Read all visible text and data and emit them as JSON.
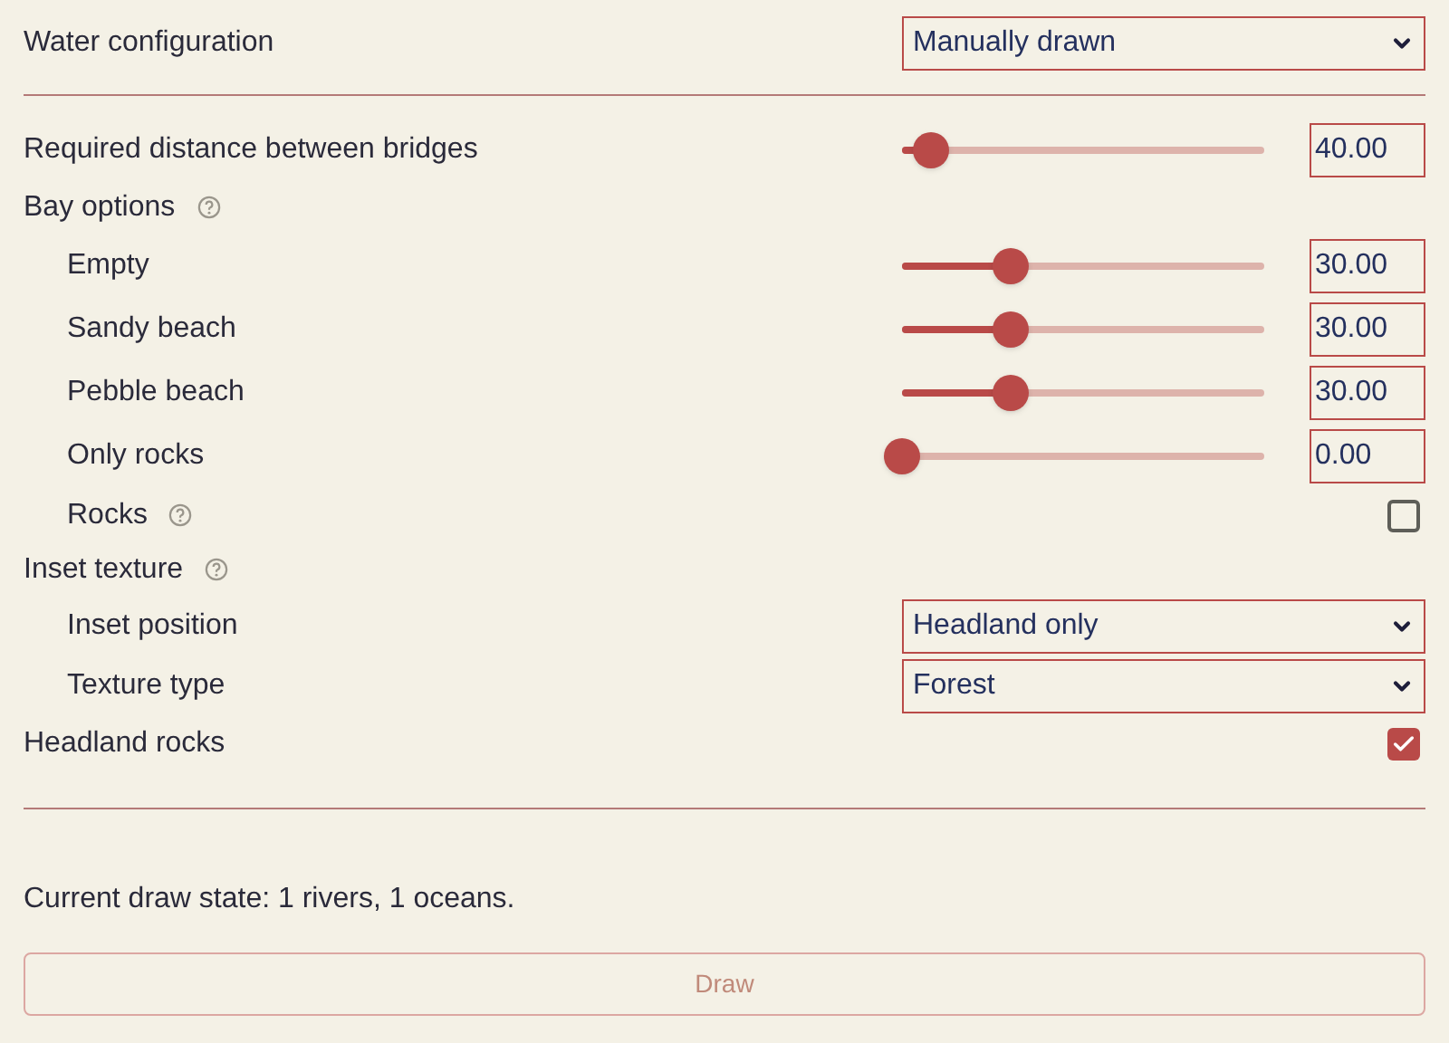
{
  "sections": [
    {
      "rows": [
        {
          "kind": "select",
          "label": "Water configuration",
          "value": "Manually drawn"
        }
      ]
    },
    {
      "rows": [
        {
          "kind": "slider",
          "label": "Required distance between bridges",
          "level": 0.08,
          "value": "40.00"
        },
        {
          "kind": "group",
          "label": "Bay options",
          "help": true,
          "children": [
            {
              "kind": "slider",
              "label": "Empty",
              "level": 0.3,
              "value": "30.00"
            },
            {
              "kind": "slider",
              "label": "Sandy beach",
              "level": 0.3,
              "value": "30.00"
            },
            {
              "kind": "slider",
              "label": "Pebble beach",
              "level": 0.3,
              "value": "30.00"
            },
            {
              "kind": "slider",
              "label": "Only rocks",
              "level": 0,
              "value": "0.00"
            },
            {
              "kind": "checkbox",
              "label": "Rocks",
              "help": true,
              "checked": false
            }
          ]
        },
        {
          "kind": "group",
          "label": "Inset texture",
          "help": true,
          "children": [
            {
              "kind": "select",
              "label": "Inset position",
              "value": "Headland only"
            },
            {
              "kind": "select",
              "label": "Texture type",
              "value": "Forest"
            }
          ]
        },
        {
          "kind": "checkbox",
          "label": "Headland rocks",
          "checked": true
        }
      ]
    }
  ],
  "status": "Current draw state: 1 rivers, 1 oceans.",
  "button": {
    "label": "Draw",
    "disabled": true
  }
}
